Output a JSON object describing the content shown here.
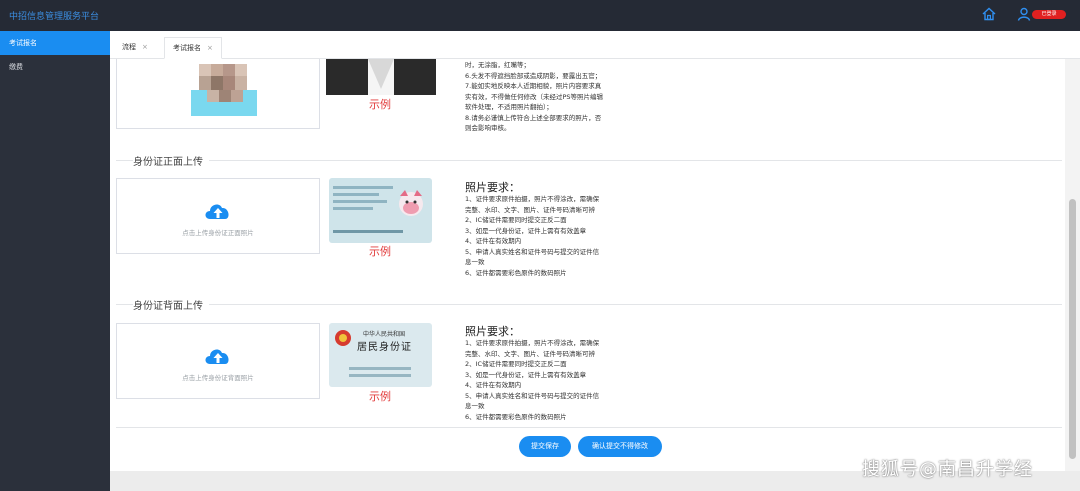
{
  "app": {
    "title": "中招信息管理服务平台"
  },
  "header": {
    "user_badge": "已登录"
  },
  "sidebar": {
    "items": [
      {
        "label": "考试报名"
      },
      {
        "label": "缴费"
      }
    ]
  },
  "tabs": [
    {
      "label": "流程"
    },
    {
      "label": "考试报名"
    }
  ],
  "common": {
    "example_label": "示例"
  },
  "photo_requirements_tail": [
    "时，无涂脂，红嘴等；",
    "6.头发不得遮挡脸部或造成阴影，要露出五官；",
    "7.能如实地反映本人近期相貌，照片内容要求真",
    "实有效，不得做任何修改（未经过PS等照片编辑",
    "软件处理，不适用照片翻拍）；",
    "8.请务必谨慎上传符合上述全部要求的照片，否",
    "则会影响审核。"
  ],
  "id_front": {
    "title": "身份证正面上传",
    "upload_hint": "点击上传身份证正面照片",
    "req_title": "照片要求：",
    "requirements": [
      "1、证件要求原件拍摄，照片不得涂改，需确保",
      "完整、水印、文字、图片、证件号码清晰可辨",
      "2、IC储证件需要同时提交正反二面",
      "3、如是一代身份证，证件上需有有效盖章",
      "4、证件在有效期内",
      "5、申请人真实姓名和证件号码与提交的证件信",
      "息一致",
      "6、证件都需要彩色原件的数码照片"
    ]
  },
  "id_back": {
    "title": "身份证背面上传",
    "upload_hint": "点击上传身份证背面照片",
    "card_line1": "中华人民共和国",
    "card_line2": "居民身份证",
    "req_title": "照片要求：",
    "requirements": [
      "1、证件要求原件拍摄，照片不得涂改，需确保",
      "完整、水印、文字、图片、证件号码清晰可辨",
      "2、IC储证件需要同时提交正反二面",
      "3、如是一代身份证，证件上需有有效盖章",
      "4、证件在有效期内",
      "5、申请人真实姓名和证件号码与提交的证件信",
      "息一致",
      "6、证件都需要彩色原件的数码照片"
    ]
  },
  "actions": {
    "save": "提交保存",
    "confirm": "确认提交不得修改"
  },
  "watermark": "搜狐号@南昌升学经"
}
